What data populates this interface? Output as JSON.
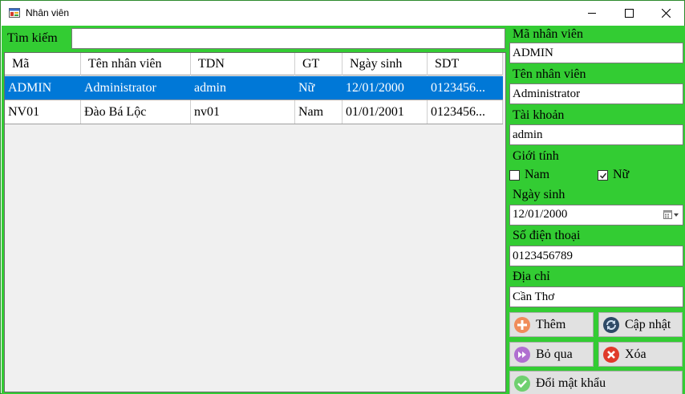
{
  "window": {
    "title": "Nhân viên"
  },
  "search": {
    "label": "Tìm kiếm",
    "value": ""
  },
  "grid": {
    "columns": [
      "Mã",
      "Tên nhân viên",
      "TDN",
      "GT",
      "Ngày sinh",
      "SDT"
    ],
    "rows": [
      [
        "ADMIN",
        "Administrator",
        "admin",
        "Nữ",
        "12/01/2000",
        "0123456..."
      ],
      [
        "NV01",
        "Đào Bá Lộc",
        "nv01",
        "Nam",
        "01/01/2001",
        "0123456..."
      ]
    ],
    "selected_row": 0
  },
  "form": {
    "ma_label": "Mã nhân viên",
    "ma_value": "ADMIN",
    "ten_label": "Tên nhân viên",
    "ten_value": "Administrator",
    "tk_label": "Tài khoản",
    "tk_value": "admin",
    "gt_label": "Giới tính",
    "nam_label": "Nam",
    "nu_label": "Nữ",
    "nam_checked": false,
    "nu_checked": true,
    "ns_label": "Ngày sinh",
    "ns_value": "12/01/2000",
    "sdt_label": "Số điện thoại",
    "sdt_value": "0123456789",
    "dc_label": "Địa chỉ",
    "dc_value": "Cần Thơ"
  },
  "buttons": {
    "them": "Thêm",
    "capnhat": "Cập nhật",
    "boqua": "Bỏ qua",
    "xoa": "Xóa",
    "doimk": "Đổi mật khẩu"
  },
  "colors": {
    "background": "#33cc33",
    "selection": "#0078d7",
    "them_icon": "#f08c5a",
    "capnhat_icon": "#2e4a66",
    "boqua_icon": "#b06fd0",
    "xoa_icon": "#e03a2a",
    "doimk_icon": "#6fd06f"
  },
  "icons": {
    "them": "plus-circle-icon",
    "capnhat": "refresh-icon",
    "boqua": "skip-forward-icon",
    "xoa": "delete-x-icon",
    "doimk": "check-circle-icon"
  }
}
